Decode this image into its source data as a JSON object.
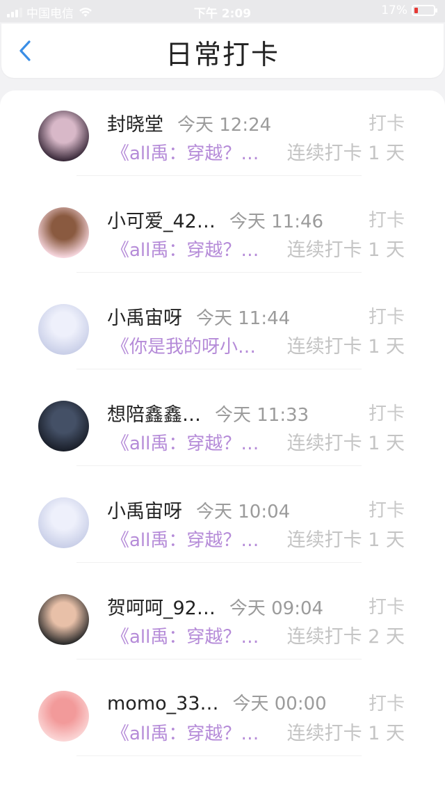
{
  "status_bar": {
    "carrier": "中国电信",
    "time": "下午 2:09",
    "battery_percent": "17%",
    "battery_level": 0.17
  },
  "header": {
    "title": "日常打卡",
    "back_icon": "chevron-left-icon"
  },
  "entries": [
    {
      "name": "封晓堂",
      "time": "今天 12:24",
      "tag": "打卡",
      "book": "《all禹：穿越？…",
      "streak": "连续打卡 1 天",
      "avatar_colors": [
        "#3a2a3a",
        "#d8b8c8"
      ]
    },
    {
      "name": "小可爱_42…",
      "time": "今天 11:46",
      "tag": "打卡",
      "book": "《all禹：穿越？…",
      "streak": "连续打卡 1 天",
      "avatar_colors": [
        "#f7d7df",
        "#8a5a40"
      ]
    },
    {
      "name": "小禹宙呀",
      "time": "今天 11:44",
      "tag": "打卡",
      "book": "《你是我的呀小…",
      "streak": "连续打卡 1 天",
      "avatar_colors": [
        "#c9cfe8",
        "#eef0fb"
      ]
    },
    {
      "name": "想陪鑫鑫…",
      "time": "今天 11:33",
      "tag": "打卡",
      "book": "《all禹：穿越？…",
      "streak": "连续打卡 1 天",
      "avatar_colors": [
        "#1a1f2a",
        "#445066"
      ]
    },
    {
      "name": "小禹宙呀",
      "time": "今天 10:04",
      "tag": "打卡",
      "book": "《all禹：穿越？…",
      "streak": "连续打卡 1 天",
      "avatar_colors": [
        "#c9cfe8",
        "#eef0fb"
      ]
    },
    {
      "name": "贺呵呵_92…",
      "time": "今天 09:04",
      "tag": "打卡",
      "book": "《all禹：穿越？…",
      "streak": "连续打卡 2 天",
      "avatar_colors": [
        "#2a2a2a",
        "#e8c0a8"
      ]
    },
    {
      "name": "momo_33…",
      "time": "今天 00:00",
      "tag": "打卡",
      "book": "《all禹：穿越？…",
      "streak": "连续打卡 1 天",
      "avatar_colors": [
        "#fbd6d6",
        "#f29a9a"
      ]
    }
  ],
  "colors": {
    "accent_back": "#3a8ee6",
    "book_text": "#b58bd8",
    "muted_text": "#c4c4c4"
  }
}
